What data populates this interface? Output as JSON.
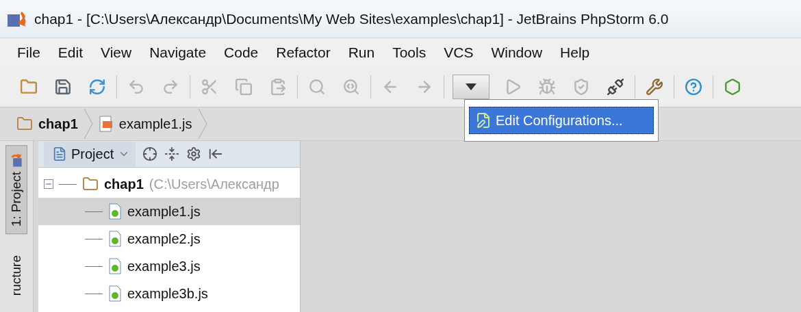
{
  "window": {
    "title": "chap1 - [C:\\Users\\Александр\\Documents\\My Web Sites\\examples\\chap1] - JetBrains PhpStorm 6.0"
  },
  "menu": [
    "File",
    "Edit",
    "View",
    "Navigate",
    "Code",
    "Refactor",
    "Run",
    "Tools",
    "VCS",
    "Window",
    "Help"
  ],
  "toolbar": [
    {
      "buttons": [
        {
          "disabled": false
        },
        {
          "disabled": false
        },
        {
          "disabled": false
        }
      ]
    },
    {
      "buttons": [
        {
          "disabled": true
        },
        {
          "disabled": true
        }
      ]
    },
    {
      "buttons": [
        {
          "disabled": true
        },
        {
          "disabled": true
        },
        {
          "disabled": true
        }
      ]
    },
    {
      "buttons": [
        {
          "disabled": true
        },
        {
          "disabled": true
        }
      ]
    },
    {
      "buttons": [
        {
          "disabled": true
        },
        {
          "disabled": true
        }
      ]
    },
    {
      "buttons": [
        {
          "disabled": false,
          "pressed": true
        },
        {
          "disabled": true
        },
        {
          "disabled": true
        },
        {
          "disabled": true
        },
        {
          "disabled": false
        }
      ]
    },
    {
      "buttons": [
        {
          "disabled": false
        }
      ]
    },
    {
      "buttons": [
        {
          "disabled": false
        }
      ]
    },
    {
      "buttons": [
        {
          "disabled": false
        }
      ]
    }
  ],
  "breadcrumbs": [
    {
      "label": "chap1",
      "kind": "folder"
    },
    {
      "label": "example1.js",
      "kind": "file"
    }
  ],
  "popup": {
    "items": [
      {
        "label": "Edit Configurations...",
        "selected": true
      }
    ]
  },
  "side_tabs": [
    {
      "label": "1: Project",
      "selected": true
    },
    {
      "label": "ructure",
      "selected": false
    }
  ],
  "project_panel": {
    "view": "Project",
    "tree": [
      {
        "label": "chap1",
        "path": "(C:\\Users\\Александр",
        "expanded": true,
        "children": [
          {
            "label": "example1.js",
            "selected": true
          },
          {
            "label": "example2.js",
            "selected": false
          },
          {
            "label": "example3.js",
            "selected": false
          },
          {
            "label": "example3b.js",
            "selected": false
          }
        ]
      }
    ]
  }
}
